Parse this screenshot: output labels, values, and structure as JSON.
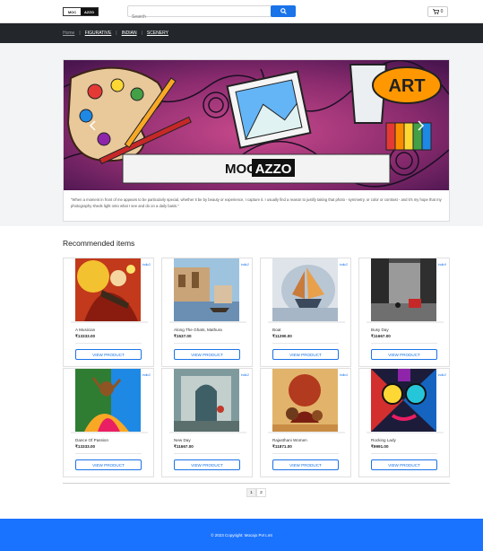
{
  "header": {
    "logo_left": "MOC",
    "logo_right": "AZZO",
    "search_placeholder": "Search",
    "cart_count": "0"
  },
  "categories": {
    "home": "Home",
    "items": [
      "FIGURATIVE",
      "INDIAN",
      "SCENERY"
    ]
  },
  "hero": {
    "brand_left": "MOC",
    "brand_right": "AZZO",
    "art_badge": "ART",
    "quote": "\"When a moment in front of me appears to be particularly special, whether it be by beauty or experience, I capture it. I usually find a reason to justify taking that photo - symmetry, or color or contrast - and it's my hope that my photography sheds light onto what I see and do on a daily basis.\""
  },
  "section_title": "Recommended items",
  "products": [
    {
      "name": "A Musician",
      "price": "₹13333.00",
      "button": "VIEW PRODUCT",
      "tag": "indic2"
    },
    {
      "name": "Along The Ghats, Mathura",
      "price": "₹1537.00",
      "button": "VIEW PRODUCT",
      "tag": "indic2"
    },
    {
      "name": "Boat",
      "price": "₹11290.00",
      "button": "VIEW PRODUCT",
      "tag": "indic2"
    },
    {
      "name": "Busy Day",
      "price": "₹11667.00",
      "button": "VIEW PRODUCT",
      "tag": "indic9"
    },
    {
      "name": "Dance Of Passion",
      "price": "₹13333.00",
      "button": "VIEW PRODUCT",
      "tag": "indic2"
    },
    {
      "name": "New Day",
      "price": "₹11667.00",
      "button": "VIEW PRODUCT",
      "tag": "indic2"
    },
    {
      "name": "Rajasthani Women",
      "price": "₹11871.00",
      "button": "VIEW PRODUCT",
      "tag": "indic4"
    },
    {
      "name": "Rocking Lady",
      "price": "₹9991.00",
      "button": "VIEW PRODUCT",
      "tag": "indic2"
    }
  ],
  "pagination": [
    "1",
    "2"
  ],
  "footer": "© 2023 Copyright: Mocajo Pvt Lmt",
  "colors": {
    "accent": "#1a73e8",
    "footer": "#1a73ff",
    "catbar": "#23272b"
  }
}
